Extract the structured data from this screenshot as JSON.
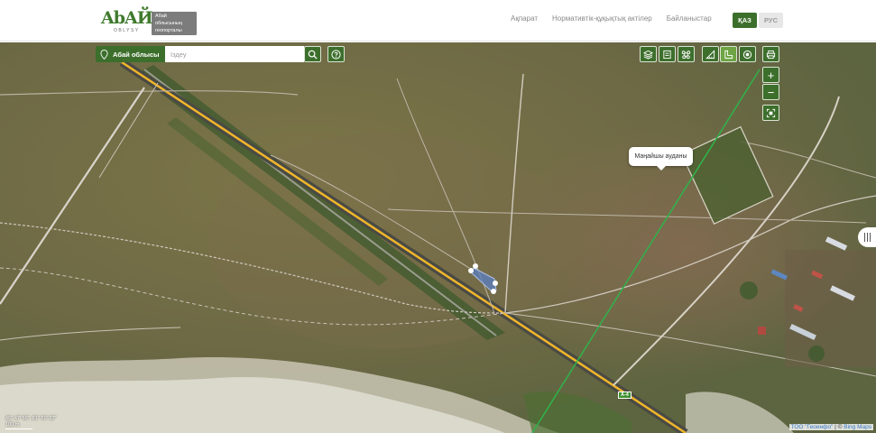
{
  "header": {
    "logo_word": "AbAЙ",
    "logo_sub": "OBLYSY",
    "logo_plate_line1": "Абай облысының",
    "logo_plate_line2": "геопорталы",
    "nav": [
      "Ақпарат",
      "Нормативтік-құқықтық актілер",
      "Байланыстар"
    ],
    "lang_active": "ҚАЗ",
    "lang_inactive": "РУС"
  },
  "search": {
    "region_label": "Абай облысы",
    "placeholder": "Іздеу"
  },
  "map": {
    "popup_text": "Маңайшы ауданы",
    "road_label": "А-4",
    "coords": "46° 47' 56\", 81° 59' 32\"",
    "scale": "100 m",
    "attribution_link1": "ТОО \"Геоинфо\"",
    "attribution_sep": " | © ",
    "attribution_link2": "Bing Maps"
  },
  "toolbar": {
    "icons": [
      "layers-icon",
      "legend-icon",
      "basemap-icon",
      "measure-distance-icon",
      "measure-area-icon",
      "locate-point-icon"
    ],
    "print_icon": "printer-icon",
    "zoom_in_label": "+",
    "zoom_out_label": "−",
    "extent_icon": "full-extent-icon"
  },
  "colors": {
    "brand_green": "#3d6f2c",
    "active_green": "#6ea443",
    "road_yellow": "#f1b62a",
    "boundary_green": "#2fb34a"
  }
}
